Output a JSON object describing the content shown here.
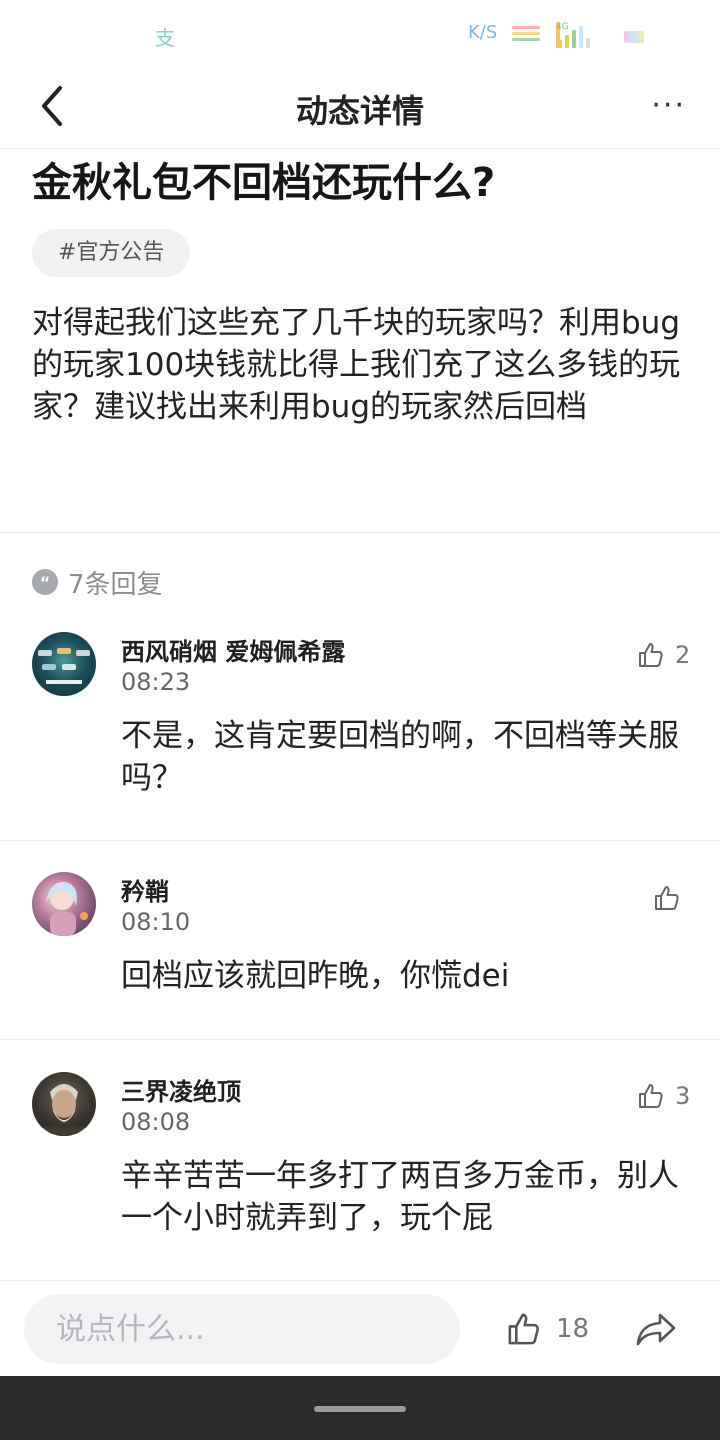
{
  "status_bar": {
    "alipay_glyph": "支",
    "speed_label": "K/S",
    "network_label": "4G"
  },
  "nav": {
    "title": "动态详情",
    "more_label": "···"
  },
  "post": {
    "title": "金秋礼包不回档还玩什么?",
    "tag": "#官方公告",
    "body": "对得起我们这些充了几千块的玩家吗？利用bug的玩家100块钱就比得上我们充了这么多钱的玩家？建议找出来利用bug的玩家然后回档"
  },
  "replies": {
    "icon_glyph": "“",
    "count_label": "7条回复"
  },
  "comments": [
    {
      "name": "西风硝烟 爱姆佩希露",
      "time": "08:23",
      "text": "不是，这肯定要回档的啊，不回档等关服吗？",
      "likes": "2"
    },
    {
      "name": "矜鞘",
      "time": "08:10",
      "text": "回档应该就回昨晚，你慌dei",
      "likes": ""
    },
    {
      "name": "三界凌绝顶",
      "time": "08:08",
      "text": "辛辛苦苦一年多打了两百多万金币，别人一个小时就弄到了，玩个屁",
      "likes": "3"
    }
  ],
  "bottom_bar": {
    "input_placeholder": "说点什么...",
    "like_count": "18"
  },
  "icons": {
    "back": "chevron-left-icon",
    "more": "more-dots-icon",
    "quote": "quote-icon",
    "like": "thumbs-up-icon",
    "share": "share-arrow-icon"
  },
  "colors": {
    "background": "#ffffff",
    "tag_bg": "#f0f1f3",
    "input_bg": "#f2f3f5",
    "secondary_text": "#8a8d92",
    "gesture_bar": "#2a2a2c"
  }
}
